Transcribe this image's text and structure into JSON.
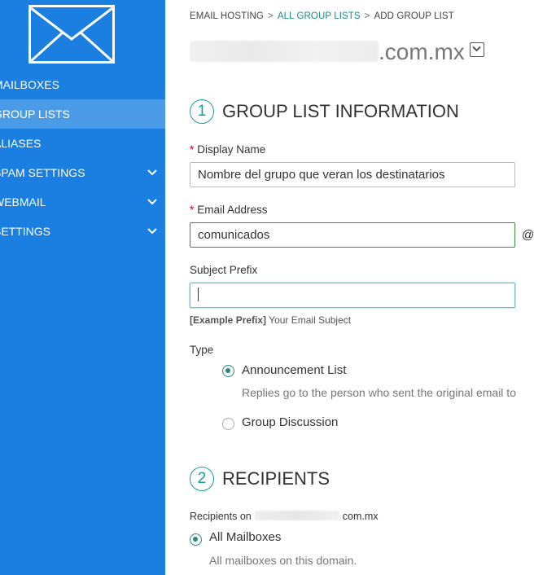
{
  "sidebar": {
    "items": [
      {
        "label": "MAILBOXES",
        "active": false,
        "expandable": false
      },
      {
        "label": "GROUP LISTS",
        "active": true,
        "expandable": false
      },
      {
        "label": "ALIASES",
        "active": false,
        "expandable": false
      },
      {
        "label": "SPAM SETTINGS",
        "active": false,
        "expandable": true
      },
      {
        "label": "WEBMAIL",
        "active": false,
        "expandable": true
      },
      {
        "label": "SETTINGS",
        "active": false,
        "expandable": true
      }
    ],
    "icons": {
      "logo": "envelope-icon",
      "expand": "chevron-down-icon"
    }
  },
  "breadcrumb": {
    "root": "EMAIL HOSTING",
    "sep": ">",
    "middle": "ALL GROUP LISTS",
    "current": "ADD GROUP LIST"
  },
  "domain": {
    "suffix": ".com.mx"
  },
  "section1": {
    "number": "1",
    "title": "GROUP LIST INFORMATION"
  },
  "form": {
    "display_name": {
      "required_mark": "*",
      "label": "Display Name",
      "value": "Nombre del grupo que veran los destinatarios"
    },
    "email_address": {
      "required_mark": "*",
      "label": "Email Address",
      "value": "comunicados",
      "at": "@"
    },
    "subject_prefix": {
      "label": "Subject Prefix",
      "value": ""
    },
    "hint": {
      "bold": "[Example Prefix]",
      "rest": " Your Email Subject"
    },
    "type": {
      "label": "Type",
      "options": [
        {
          "label": "Announcement List",
          "selected": true,
          "description": "Replies go to the person who sent the original email to"
        },
        {
          "label": "Group Discussion",
          "selected": false
        }
      ]
    }
  },
  "section2": {
    "number": "2",
    "title": "RECIPIENTS"
  },
  "recipients": {
    "prefix": "Recipients on",
    "suffix": "com.mx",
    "option": {
      "label": "All Mailboxes",
      "selected": true,
      "description": "All mailboxes on this domain."
    }
  },
  "colors": {
    "sidebar": "#1a7fe0",
    "sidebar_active": "#4a9ce8",
    "accent": "#1a9a9a",
    "required": "#d0021b"
  }
}
